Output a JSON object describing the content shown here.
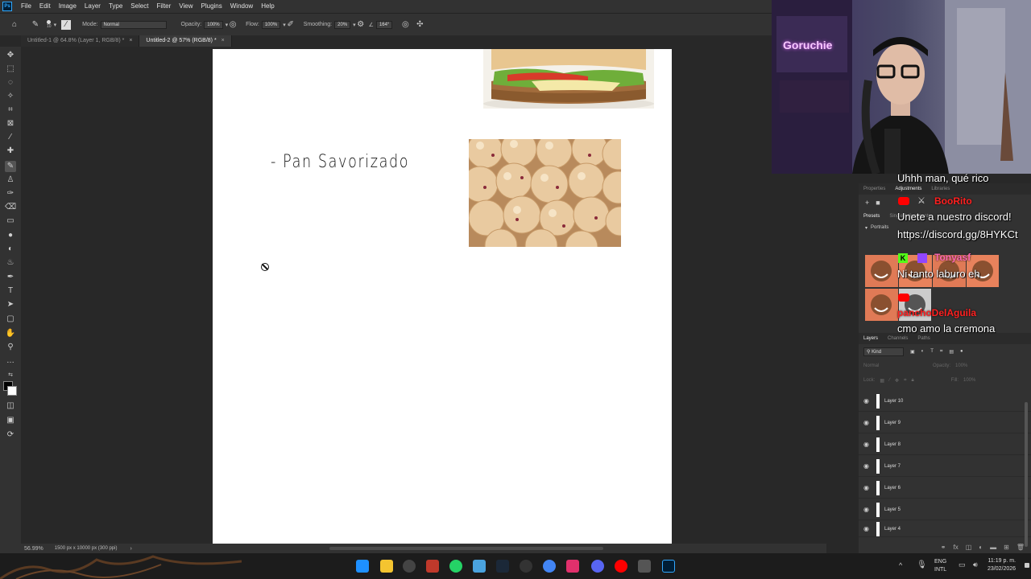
{
  "menubar": {
    "items": [
      "File",
      "Edit",
      "Image",
      "Layer",
      "Type",
      "Select",
      "Filter",
      "View",
      "Plugins",
      "Window",
      "Help"
    ]
  },
  "options": {
    "brush_size": "10",
    "mode_label": "Mode:",
    "mode_value": "Normal",
    "opacity_label": "Opacity:",
    "opacity_value": "100%",
    "flow_label": "Flow:",
    "flow_value": "100%",
    "smoothing_label": "Smoothing:",
    "smoothing_value": "20%",
    "angle_value": "164°"
  },
  "tabs": [
    {
      "label": "Untitled-1 @ 64.8% (Layer 1, RGB/8) *",
      "active": false
    },
    {
      "label": "Untitled-2 @ 57% (RGB/8) *",
      "active": true
    }
  ],
  "canvas": {
    "handwritten_text": "- Pan Savorizado"
  },
  "status": {
    "zoom": "56.99%",
    "doc_size": "1500 px x 10000 px (300 ppi)"
  },
  "panels": {
    "top_tabs": [
      "Properties",
      "Adjustments",
      "Libraries"
    ],
    "sub_tabs": [
      "Presets",
      "Single Adjustments"
    ],
    "portraits_label": "Portraits",
    "layer_tabs": [
      "Layers",
      "Channels",
      "Paths"
    ],
    "kind_label": "Kind",
    "blend_mode": "Normal",
    "opacity_label": "Opacity:",
    "opacity_value": "100%",
    "lock_label": "Lock:",
    "fill_label": "Fill:",
    "fill_value": "100%",
    "layers": [
      "Layer 10",
      "Layer 9",
      "Layer 8",
      "Layer 7",
      "Layer 6",
      "Layer 5",
      "Layer 4"
    ]
  },
  "webcam": {
    "sign_text": "Goruchie"
  },
  "chat": [
    {
      "user": "",
      "message": "Uhhh man, qué rico"
    },
    {
      "user": "BooRito",
      "message": "Unete a nuestro discord!"
    },
    {
      "user": "",
      "message": "https://discord.gg/8HYKCt"
    },
    {
      "user": "Tonyasf",
      "message": "Ni tanto laburo eh"
    },
    {
      "user": "panchoDelAguila",
      "message": "cmo amo la cremona"
    }
  ],
  "taskbar": {
    "lang_top": "ENG",
    "lang_bottom": "INTL",
    "time": "11:19 p. m.",
    "date": "23/02/2026"
  },
  "colors": {
    "ps_blue": "#31a8ff",
    "youtube_red": "#ff0000",
    "kick_green": "#53fc18",
    "twitch_purple": "#9146ff",
    "tonyasf_color": "#ff69b4",
    "booRito_color": "#ff2020",
    "pancho_color": "#ff2020"
  }
}
